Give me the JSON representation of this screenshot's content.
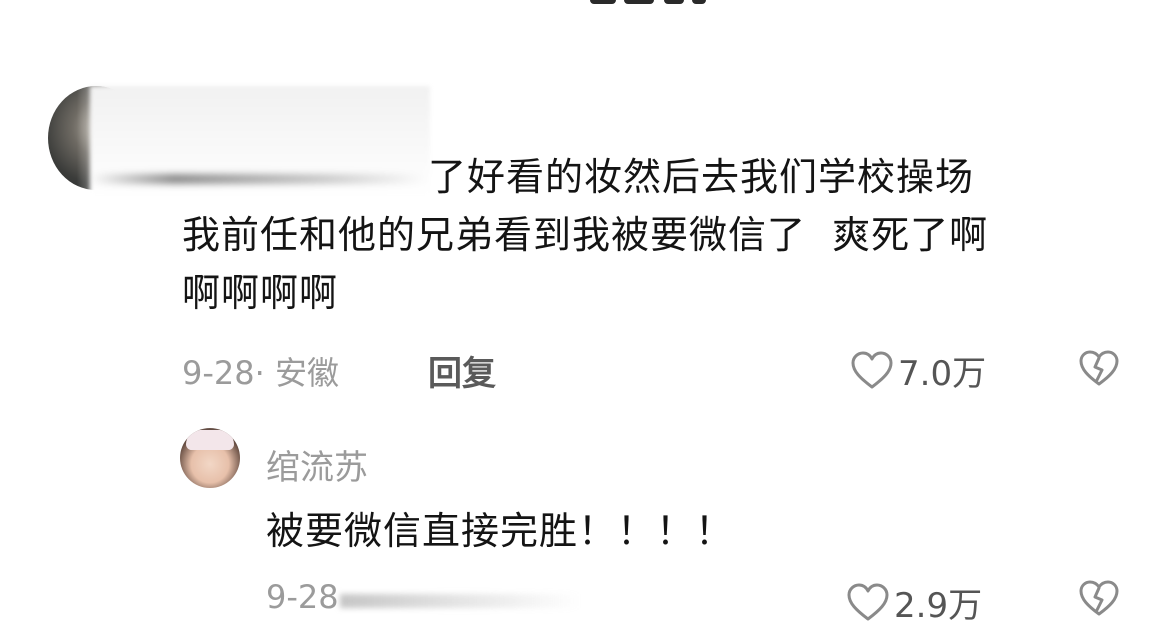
{
  "comment": {
    "line1": "了好看的妆然后去我们学校操场",
    "line2": "我前任和他的兄弟看到我被要微信了  爽死了啊",
    "line3": "啊啊啊啊",
    "meta": "9-28· 安徽",
    "reply_label": "回复",
    "likes": "7.0万"
  },
  "reply": {
    "author": "绾流苏",
    "text": "被要微信直接完胜！！！！",
    "meta": "9-28",
    "likes": "2.9万"
  },
  "icons": {
    "like": "heart-outline-icon",
    "dislike": "broken-heart-icon"
  }
}
